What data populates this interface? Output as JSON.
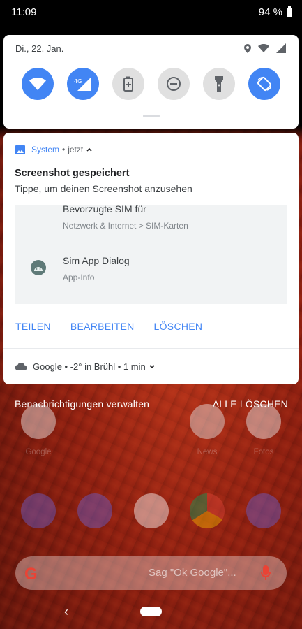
{
  "status_bar": {
    "time": "11:09",
    "battery": "94 %"
  },
  "quick_settings": {
    "date": "Di., 22. Jan.",
    "tiles": [
      {
        "name": "wifi",
        "state": "on"
      },
      {
        "name": "mobile-data-4g",
        "label": "4G",
        "state": "on"
      },
      {
        "name": "battery-saver",
        "state": "off"
      },
      {
        "name": "do-not-disturb",
        "state": "off"
      },
      {
        "name": "flashlight",
        "state": "off"
      },
      {
        "name": "auto-rotate",
        "state": "on"
      }
    ]
  },
  "notification": {
    "app": "System",
    "time": "jetzt",
    "title": "Screenshot gespeichert",
    "text": "Tippe, um deinen Screenshot anzusehen",
    "preview": {
      "row1_title": "Bevorzugte SIM für",
      "row1_sub": "Netzwerk & Internet > SIM-Karten",
      "row2_title": "Sim App Dialog",
      "row2_sub": "App-Info"
    },
    "actions": {
      "share": "TEILEN",
      "edit": "BEARBEITEN",
      "delete": "LÖSCHEN"
    }
  },
  "weather": {
    "text": "Google • -2° in Brühl • 1 min"
  },
  "manage": {
    "left": "Benachrichtigungen verwalten",
    "right": "ALLE LÖSCHEN"
  },
  "home": {
    "labels": {
      "google": "Google",
      "news": "News",
      "fotos": "Fotos"
    },
    "search_hint": "Sag \"Ok Google\"..."
  },
  "colors": {
    "accent": "#4285f4",
    "tile_off": "#e0e0e0"
  }
}
